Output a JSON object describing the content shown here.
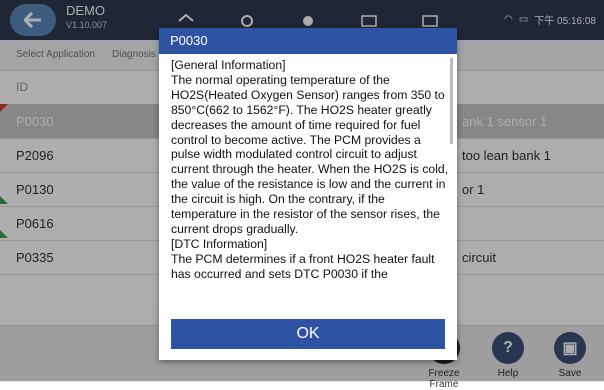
{
  "app": {
    "title": "DEMO",
    "version": "V1.10.007"
  },
  "status": {
    "time": "下午 05:16:08"
  },
  "breadcrumb": [
    "Select Application",
    "Diagnosis"
  ],
  "table": {
    "header_id": "ID",
    "rows": [
      {
        "id": "P0030",
        "desc": "ank 1 sensor 1"
      },
      {
        "id": "P2096",
        "desc": "too lean bank 1"
      },
      {
        "id": "P0130",
        "desc": "or 1"
      },
      {
        "id": "P0616",
        "desc": ""
      },
      {
        "id": "P0335",
        "desc": "circuit"
      }
    ]
  },
  "bottom": {
    "freeze": "Freeze Frame",
    "help": "Help",
    "save": "Save"
  },
  "dialog": {
    "title": "P0030",
    "body": "[General Information]\nThe normal operating temperature of the HO2S(Heated Oxygen Sensor) ranges from 350 to 850°C(662 to 1562°F). The HO2S heater greatly decreases the amount of time required for fuel control to become active. The PCM provides a pulse width modulated control circuit to adjust current through the heater. When the HO2S is cold, the value of the resistance is low and the current in the circuit is high. On the contrary, if the temperature in the resistor of the sensor rises, the current drops gradually.\n[DTC Information]\nThe PCM determines if a front HO2S heater fault has occurred and sets DTC P0030 if the",
    "ok": "OK"
  },
  "colors": {
    "topbar": "#2f3a50",
    "dialog_blue": "#2f53a3",
    "selected_row": "#c7c7c7"
  }
}
